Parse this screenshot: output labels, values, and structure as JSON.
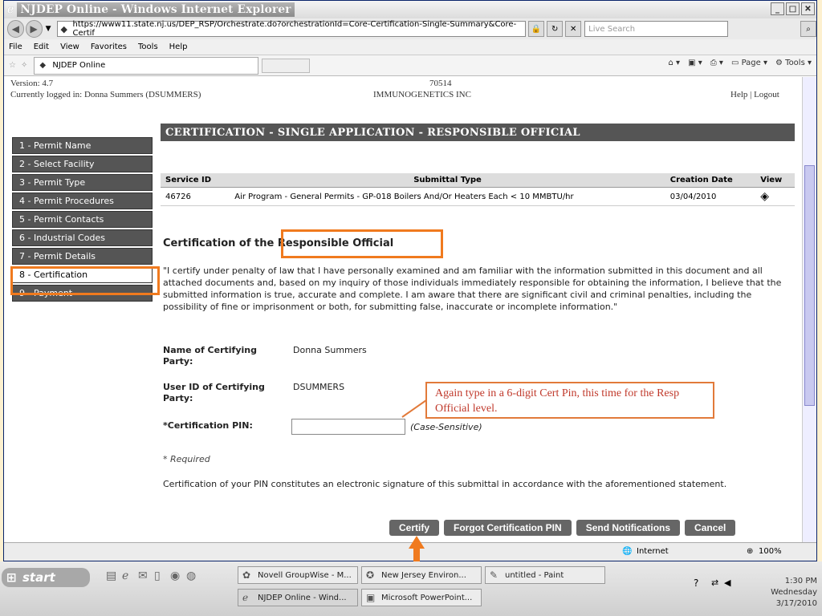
{
  "window": {
    "title": "NJDEP Online - Windows Internet Explorer",
    "url": "https://www11.state.nj.us/DEP_RSP/Orchestrate.do?orchestrationId=Core-Certification-Single-Summary&Core-Certif",
    "search_placeholder": "Live Search",
    "menu": [
      "File",
      "Edit",
      "View",
      "Favorites",
      "Tools",
      "Help"
    ],
    "tab_label": "NJDEP Online",
    "tools": {
      "page": "Page",
      "tools": "Tools"
    }
  },
  "page": {
    "version": "Version: 4.7",
    "logged_in": "Currently logged in: Donna Summers (DSUMMERS)",
    "id_code": "70514",
    "company": "IMMUNOGENETICS INC",
    "help_logout": "Help | Logout",
    "header": "CERTIFICATION - SINGLE APPLICATION - RESPONSIBLE OFFICIAL",
    "nav": [
      "1 - Permit Name",
      "2 - Select Facility",
      "3 - Permit Type",
      "4 - Permit Procedures",
      "5 - Permit Contacts",
      "6 - Industrial Codes",
      "7 - Permit Details",
      "8 - Certification",
      "9 - Payment"
    ],
    "table": {
      "headers": [
        "Service ID",
        "Submittal Type",
        "Creation Date",
        "View"
      ],
      "row": [
        "46726",
        "Air Program - General Permits - GP-018 Boilers And/Or Heaters Each < 10 MMBTU/hr",
        "03/04/2010"
      ]
    },
    "cert_title_a": "Certification of the ",
    "cert_title_b": "Responsible Official",
    "cert_text": "\"I certify under penalty of law that I have personally examined and am familiar with the information submitted in this document and all attached documents and, based on my inquiry of those individuals immediately responsible for obtaining the information, I believe that the submitted information is true, accurate and complete. I am aware that there are significant civil and criminal penalties, including the possibility of fine or imprisonment or both, for submitting false, inaccurate or incomplete information.\"",
    "name_label": "Name of Certifying Party:",
    "name_value": "Donna Summers",
    "userid_label": "User ID of Certifying Party:",
    "userid_value": "DSUMMERS",
    "pin_label": "*Certification PIN:",
    "pin_value": "",
    "case_note": "(Case-Sensitive)",
    "required": "* Required",
    "signature_note": "Certification of your PIN constitutes an electronic signature of this submittal in accordance with the aforementioned statement.",
    "buttons": [
      "Certify",
      "Forgot Certification PIN",
      "Send Notifications",
      "Cancel"
    ]
  },
  "callout": "Again type in a 6-digit Cert Pin, this time for the Resp Official level.",
  "status": {
    "zone": "Internet",
    "zoom": "100%"
  },
  "taskbar": {
    "start": "start",
    "items": [
      "Novell GroupWise - M...",
      "New Jersey Environ...",
      "untitled - Paint",
      "NJDEP Online - Wind...",
      "Microsoft PowerPoint..."
    ],
    "time": "1:30 PM",
    "day": "Wednesday",
    "date": "3/17/2010"
  },
  "colors": {
    "accent": "#f07a1e",
    "nav_bg": "#555555",
    "button_bg": "#666666"
  }
}
